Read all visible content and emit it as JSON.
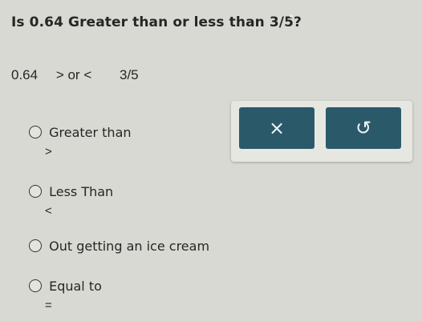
{
  "question": {
    "title": "Is 0.64 Greater than or less than 3/5?",
    "expression": {
      "left": "0.64",
      "middle": "> or <",
      "right": "3/5"
    }
  },
  "options": [
    {
      "label": "Greater than",
      "symbol": ">"
    },
    {
      "label": "Less Than",
      "symbol": "<"
    },
    {
      "label": "Out getting an ice cream",
      "symbol": ""
    },
    {
      "label": "Equal to",
      "symbol": "="
    }
  ],
  "answer_panel": {
    "close_glyph": "×",
    "undo_glyph": "↺",
    "button_color": "#2a5a6a"
  }
}
